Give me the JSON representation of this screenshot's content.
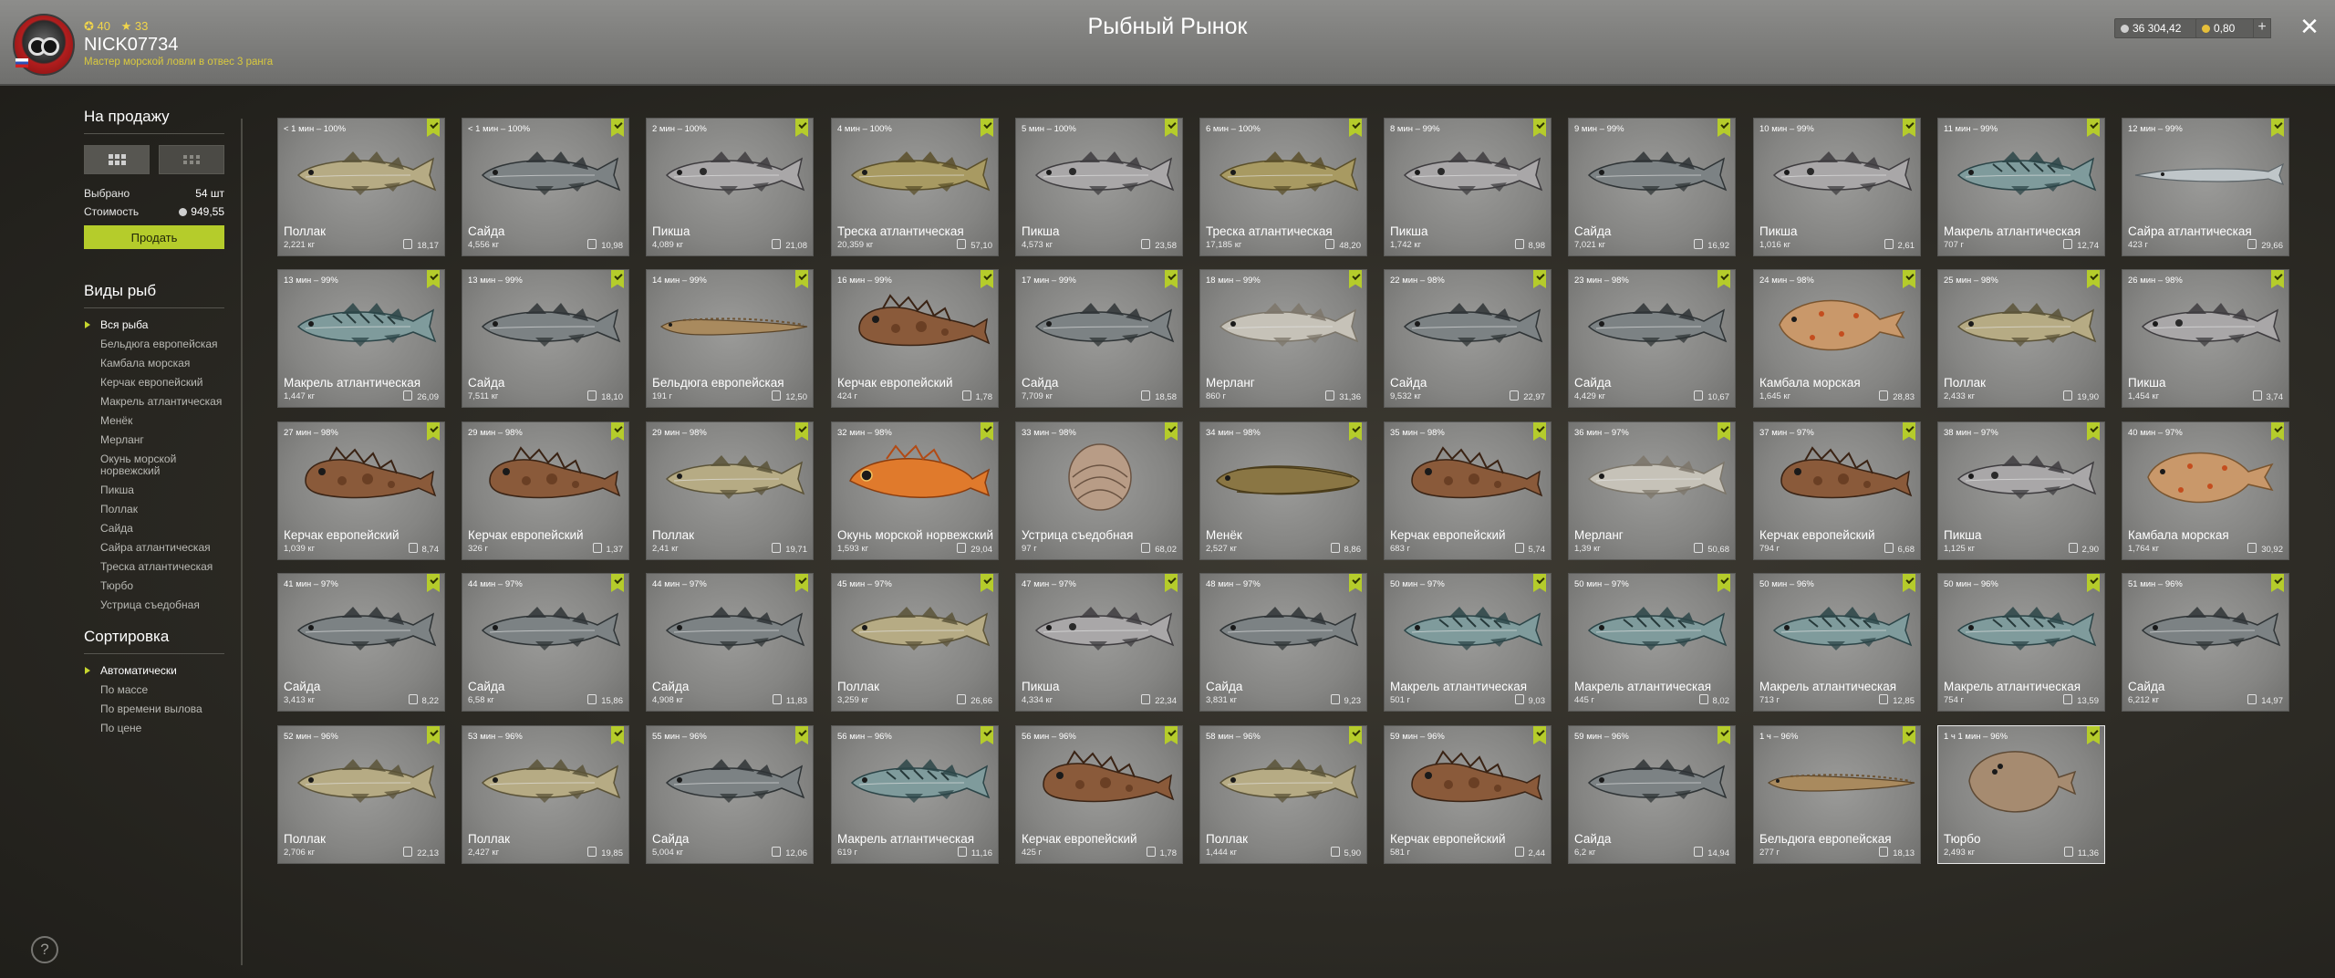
{
  "header": {
    "title": "Рыбный Рынок",
    "player": {
      "username": "NICK07734",
      "stat_level": "40",
      "stat_rank": "33",
      "rank_title": "Мастер морской ловли в отвес 3 ранга"
    },
    "currency_silver": "36 304,42",
    "currency_gold": "0,80",
    "plus_label": "+",
    "close_label": "✕"
  },
  "sidebar": {
    "for_sale_title": "На продажу",
    "selected_label": "Выбрано",
    "selected_value": "54 шт",
    "cost_label": "Стоимость",
    "cost_value": "949,55",
    "sell_button": "Продать",
    "fish_types_title": "Виды рыб",
    "fish_types": [
      "Вся рыба",
      "Бельдюга европейская",
      "Камбала морская",
      "Керчак европейский",
      "Макрель атлантическая",
      "Менёк",
      "Мерланг",
      "Окунь морской норвежский",
      "Пикша",
      "Поллак",
      "Сайда",
      "Сайра атлантическая",
      "Треска атлантическая",
      "Тюрбо",
      "Устрица съедобная"
    ],
    "sort_title": "Сортировка",
    "sort_options": [
      "Автоматически",
      "По массе",
      "По времени вылова",
      "По цене"
    ],
    "help_label": "?"
  },
  "colors": {
    "accent": "#b5cc2b",
    "header_bg": "#7f7f7d",
    "card_bg": "#8a8a88"
  },
  "fish": [
    {
      "time": "< 1 мин – 100%",
      "name": "Поллак",
      "weight": "2,221 кг",
      "price": "18,17",
      "kind": "pollock"
    },
    {
      "time": "< 1 мин – 100%",
      "name": "Сайда",
      "weight": "4,556 кг",
      "price": "10,98",
      "kind": "saithe"
    },
    {
      "time": "2 мин – 100%",
      "name": "Пикша",
      "weight": "4,089 кг",
      "price": "21,08",
      "kind": "haddock"
    },
    {
      "time": "4 мин – 100%",
      "name": "Треска атлантическая",
      "weight": "20,359 кг",
      "price": "57,10",
      "kind": "cod"
    },
    {
      "time": "5 мин – 100%",
      "name": "Пикша",
      "weight": "4,573 кг",
      "price": "23,58",
      "kind": "haddock"
    },
    {
      "time": "6 мин – 100%",
      "name": "Треска атлантическая",
      "weight": "17,185 кг",
      "price": "48,20",
      "kind": "cod"
    },
    {
      "time": "8 мин – 99%",
      "name": "Пикша",
      "weight": "1,742 кг",
      "price": "8,98",
      "kind": "haddock"
    },
    {
      "time": "9 мин – 99%",
      "name": "Сайда",
      "weight": "7,021 кг",
      "price": "16,92",
      "kind": "saithe"
    },
    {
      "time": "10 мин – 99%",
      "name": "Пикша",
      "weight": "1,016 кг",
      "price": "2,61",
      "kind": "haddock"
    },
    {
      "time": "11 мин – 99%",
      "name": "Макрель атлантическая",
      "weight": "707 г",
      "price": "12,74",
      "kind": "mackerel"
    },
    {
      "time": "12 мин – 99%",
      "name": "Сайра атлантическая",
      "weight": "423 г",
      "price": "29,66",
      "kind": "saury"
    },
    {
      "time": "13 мин – 99%",
      "name": "Макрель атлантическая",
      "weight": "1,447 кг",
      "price": "26,09",
      "kind": "mackerel"
    },
    {
      "time": "13 мин – 99%",
      "name": "Сайда",
      "weight": "7,511 кг",
      "price": "18,10",
      "kind": "saithe"
    },
    {
      "time": "14 мин – 99%",
      "name": "Бельдюга европейская",
      "weight": "191 г",
      "price": "12,50",
      "kind": "eelpout"
    },
    {
      "time": "16 мин – 99%",
      "name": "Керчак европейский",
      "weight": "424 г",
      "price": "1,78",
      "kind": "sculpin"
    },
    {
      "time": "17 мин – 99%",
      "name": "Сайда",
      "weight": "7,709 кг",
      "price": "18,58",
      "kind": "saithe"
    },
    {
      "time": "18 мин – 99%",
      "name": "Мерланг",
      "weight": "860 г",
      "price": "31,36",
      "kind": "whiting"
    },
    {
      "time": "22 мин – 98%",
      "name": "Сайда",
      "weight": "9,532 кг",
      "price": "22,97",
      "kind": "saithe"
    },
    {
      "time": "23 мин – 98%",
      "name": "Сайда",
      "weight": "4,429 кг",
      "price": "10,67",
      "kind": "saithe"
    },
    {
      "time": "24 мин – 98%",
      "name": "Камбала морская",
      "weight": "1,645 кг",
      "price": "28,83",
      "kind": "plaice"
    },
    {
      "time": "25 мин – 98%",
      "name": "Поллак",
      "weight": "2,433 кг",
      "price": "19,90",
      "kind": "pollock"
    },
    {
      "time": "26 мин – 98%",
      "name": "Пикша",
      "weight": "1,454 кг",
      "price": "3,74",
      "kind": "haddock"
    },
    {
      "time": "27 мин – 98%",
      "name": "Керчак европейский",
      "weight": "1,039 кг",
      "price": "8,74",
      "kind": "sculpin"
    },
    {
      "time": "29 мин – 98%",
      "name": "Керчак европейский",
      "weight": "326 г",
      "price": "1,37",
      "kind": "sculpin"
    },
    {
      "time": "29 мин – 98%",
      "name": "Поллак",
      "weight": "2,41 кг",
      "price": "19,71",
      "kind": "pollock"
    },
    {
      "time": "32 мин – 98%",
      "name": "Окунь морской норвежский",
      "weight": "1,593 кг",
      "price": "29,04",
      "kind": "redfish"
    },
    {
      "time": "33 мин – 98%",
      "name": "Устрица съедобная",
      "weight": "97 г",
      "price": "68,02",
      "kind": "oyster"
    },
    {
      "time": "34 мин – 98%",
      "name": "Менёк",
      "weight": "2,527 кг",
      "price": "8,86",
      "kind": "tusk"
    },
    {
      "time": "35 мин – 98%",
      "name": "Керчак европейский",
      "weight": "683 г",
      "price": "5,74",
      "kind": "sculpin"
    },
    {
      "time": "36 мин – 97%",
      "name": "Мерланг",
      "weight": "1,39 кг",
      "price": "50,68",
      "kind": "whiting"
    },
    {
      "time": "37 мин – 97%",
      "name": "Керчак европейский",
      "weight": "794 г",
      "price": "6,68",
      "kind": "sculpin"
    },
    {
      "time": "38 мин – 97%",
      "name": "Пикша",
      "weight": "1,125 кг",
      "price": "2,90",
      "kind": "haddock"
    },
    {
      "time": "40 мин – 97%",
      "name": "Камбала морская",
      "weight": "1,764 кг",
      "price": "30,92",
      "kind": "plaice"
    },
    {
      "time": "41 мин – 97%",
      "name": "Сайда",
      "weight": "3,413 кг",
      "price": "8,22",
      "kind": "saithe"
    },
    {
      "time": "44 мин – 97%",
      "name": "Сайда",
      "weight": "6,58 кг",
      "price": "15,86",
      "kind": "saithe"
    },
    {
      "time": "44 мин – 97%",
      "name": "Сайда",
      "weight": "4,908 кг",
      "price": "11,83",
      "kind": "saithe"
    },
    {
      "time": "45 мин – 97%",
      "name": "Поллак",
      "weight": "3,259 кг",
      "price": "26,66",
      "kind": "pollock"
    },
    {
      "time": "47 мин – 97%",
      "name": "Пикша",
      "weight": "4,334 кг",
      "price": "22,34",
      "kind": "haddock"
    },
    {
      "time": "48 мин – 97%",
      "name": "Сайда",
      "weight": "3,831 кг",
      "price": "9,23",
      "kind": "saithe"
    },
    {
      "time": "50 мин – 97%",
      "name": "Макрель атлантическая",
      "weight": "501 г",
      "price": "9,03",
      "kind": "mackerel"
    },
    {
      "time": "50 мин – 97%",
      "name": "Макрель атлантическая",
      "weight": "445 г",
      "price": "8,02",
      "kind": "mackerel"
    },
    {
      "time": "50 мин – 96%",
      "name": "Макрель атлантическая",
      "weight": "713 г",
      "price": "12,85",
      "kind": "mackerel"
    },
    {
      "time": "50 мин – 96%",
      "name": "Макрель атлантическая",
      "weight": "754 г",
      "price": "13,59",
      "kind": "mackerel"
    },
    {
      "time": "51 мин – 96%",
      "name": "Сайда",
      "weight": "6,212 кг",
      "price": "14,97",
      "kind": "saithe"
    },
    {
      "time": "52 мин – 96%",
      "name": "Поллак",
      "weight": "2,706 кг",
      "price": "22,13",
      "kind": "pollock"
    },
    {
      "time": "53 мин – 96%",
      "name": "Поллак",
      "weight": "2,427 кг",
      "price": "19,85",
      "kind": "pollock"
    },
    {
      "time": "55 мин – 96%",
      "name": "Сайда",
      "weight": "5,004 кг",
      "price": "12,06",
      "kind": "saithe"
    },
    {
      "time": "56 мин – 96%",
      "name": "Макрель атлантическая",
      "weight": "619 г",
      "price": "11,16",
      "kind": "mackerel"
    },
    {
      "time": "56 мин – 96%",
      "name": "Керчак европейский",
      "weight": "425 г",
      "price": "1,78",
      "kind": "sculpin"
    },
    {
      "time": "58 мин – 96%",
      "name": "Поллак",
      "weight": "1,444 кг",
      "price": "5,90",
      "kind": "pollock"
    },
    {
      "time": "59 мин – 96%",
      "name": "Керчак европейский",
      "weight": "581 г",
      "price": "2,44",
      "kind": "sculpin"
    },
    {
      "time": "59 мин – 96%",
      "name": "Сайда",
      "weight": "6,2 кг",
      "price": "14,94",
      "kind": "saithe"
    },
    {
      "time": "1 ч – 96%",
      "name": "Бельдюга европейская",
      "weight": "277 г",
      "price": "18,13",
      "kind": "eelpout"
    },
    {
      "time": "1 ч 1 мин – 96%",
      "name": "Тюрбо",
      "weight": "2,493 кг",
      "price": "11,36",
      "kind": "turbot",
      "selected": true
    }
  ]
}
